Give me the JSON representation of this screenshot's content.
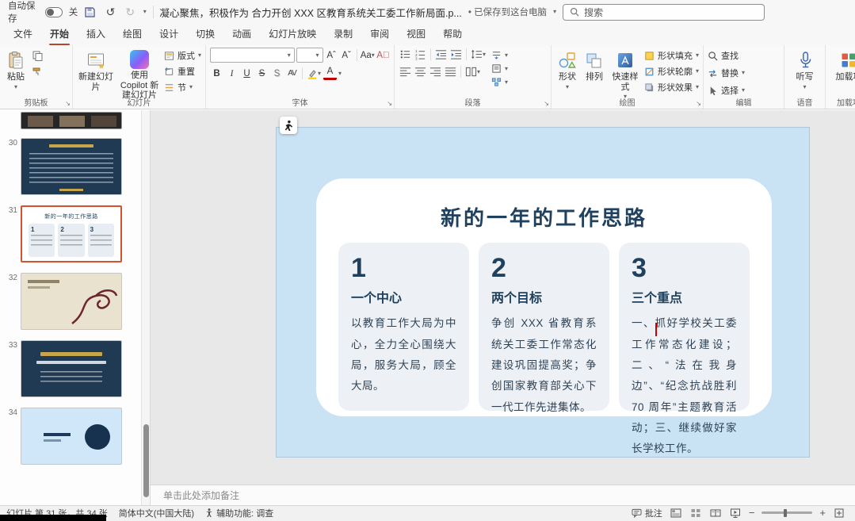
{
  "titlebar": {
    "autosave_label": "自动保存",
    "autosave_state": "关",
    "doc_title": "凝心聚焦，积极作为 合力开创 XXX 区教育系统关工委工作新局面.p...",
    "saved_badge": "已保存到这台电脑",
    "search_placeholder": "搜索"
  },
  "icons": {
    "caret_down": "▾",
    "undo": "↺",
    "redo": "↻",
    "zoom_out": "−",
    "zoom_in": "+"
  },
  "ribbon": {
    "tabs": [
      "文件",
      "开始",
      "插入",
      "绘图",
      "设计",
      "切换",
      "动画",
      "幻灯片放映",
      "录制",
      "审阅",
      "视图",
      "帮助"
    ],
    "groups": {
      "clipboard": {
        "paste": "粘贴",
        "label": "剪贴板"
      },
      "slides": {
        "new_slide": "新建幻灯片",
        "copilot": "使用 Copilot 新建幻灯片",
        "layout": "版式",
        "reset": "重置",
        "section": "节",
        "label": "幻灯片"
      },
      "font": {
        "label": "字体",
        "bold": "B",
        "italic": "I",
        "underline": "U",
        "strike": "S",
        "shadow": "S",
        "spacing": "AV",
        "case_btn": "Aa",
        "color": "A"
      },
      "paragraph": {
        "label": "段落"
      },
      "drawing": {
        "shapes": "形状",
        "arrange": "排列",
        "quick_styles": "快速样式",
        "fill": "形状填充",
        "outline": "形状轮廓",
        "effects": "形状效果",
        "label": "绘图"
      },
      "editing": {
        "find": "查找",
        "replace": "替换",
        "select": "选择",
        "label": "编辑"
      },
      "voice": {
        "dictate": "听写",
        "label": "语音"
      },
      "addins": {
        "button": "加载项",
        "label": "加载项"
      }
    }
  },
  "slide_panel": {
    "numbers": [
      "30",
      "31",
      "32",
      "33",
      "34"
    ]
  },
  "slide": {
    "title": "新的一年的工作思路",
    "cards": [
      {
        "number": "1",
        "heading": "一个中心",
        "body": "以教育工作大局为中心，全力全心围绕大局，服务大局，顾全大局。"
      },
      {
        "number": "2",
        "heading": "两个目标",
        "body": "争创 XXX 省教育系统关工委工作常态化建设巩固提高奖；争创国家教育部关心下一代工作先进集体。"
      },
      {
        "number": "3",
        "heading": "三个重点",
        "body": "一、抓好学校关工委工作常态化建设；二、“法在我身边”、“纪念抗战胜利 70 周年”主题教育活动；三、继续做好家长学校工作。"
      }
    ]
  },
  "notes_placeholder": "单击此处添加备注",
  "statusbar": {
    "slide_info": "幻灯片 第 31 张，共 34 张",
    "language": "简体中文(中国大陆)",
    "accessibility": "辅助功能: 调查",
    "comments": "批注"
  },
  "colors": {
    "accent": "#b7472a",
    "selection": "#d35230",
    "slide_bg": "#c9e2f4",
    "navy": "#20415e"
  }
}
